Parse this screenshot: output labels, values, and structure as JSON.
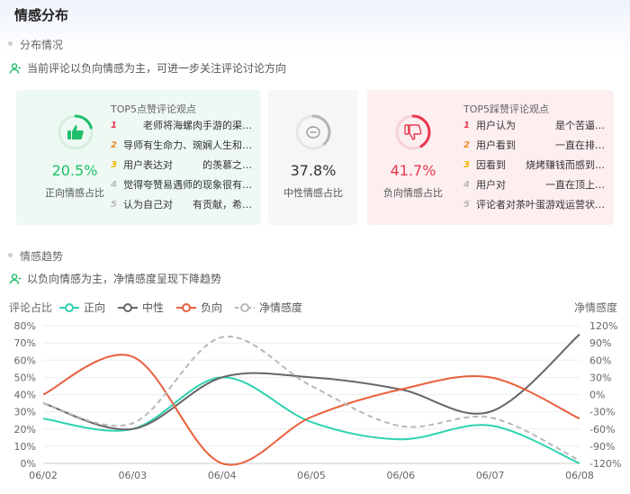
{
  "title": "情感分布",
  "distribution": {
    "label": "分布情况",
    "note": "当前评论以负向情感为主，可进一步关注评论讨论方向",
    "positive": {
      "value": 20.5,
      "pct_text": "20.5%",
      "label": "正向情感占比",
      "color": "#1fbf6b",
      "top_title": "TOP5点赞评论观点",
      "items": [
        {
          "rank": "1",
          "text": "　　老师将海螺肉手游的渠…"
        },
        {
          "rank": "2",
          "text": "导师有生命力、琬娴人生和…"
        },
        {
          "rank": "3",
          "text": "用户表达对　　　的羡慕之…"
        },
        {
          "rank": "4",
          "text": "觉得夸赞易遇师的现象很有…"
        },
        {
          "rank": "5",
          "text": "认为自己对　　有贡献，希…"
        }
      ]
    },
    "neutral": {
      "value": 37.8,
      "pct_text": "37.8%",
      "label": "中性情感占比",
      "color": "#999999"
    },
    "negative": {
      "value": 41.7,
      "pct_text": "41.7%",
      "label": "负向情感占比",
      "color": "#e8384f",
      "top_title": "TOP5踩赞评论观点",
      "items": [
        {
          "rank": "1",
          "text": "用户认为　　　　是个苦逼…"
        },
        {
          "rank": "2",
          "text": "用户看到　　　　一直在排…"
        },
        {
          "rank": "3",
          "text": "因看到　　烧烤赚钱而感到…"
        },
        {
          "rank": "4",
          "text": "用户对　　　　一直在顶上…"
        },
        {
          "rank": "5",
          "text": "评论者对茶叶蛋游戏运营状…"
        }
      ]
    }
  },
  "trend": {
    "label": "情感趋势",
    "note": "以负向情感为主，净情感度呈现下降趋势"
  },
  "chart_data": {
    "type": "line",
    "x": [
      "06/02",
      "06/03",
      "06/04",
      "06/05",
      "06/06",
      "06/07",
      "06/08"
    ],
    "ylabel": "评论占比",
    "y2label": "净情感度",
    "ylim": [
      0,
      80
    ],
    "y_ticks": [
      "0%",
      "10%",
      "20%",
      "30%",
      "40%",
      "50%",
      "60%",
      "70%",
      "80%"
    ],
    "y2lim": [
      -120,
      120
    ],
    "y2_ticks": [
      "-120%",
      "-90%",
      "-60%",
      "-30%",
      "0%",
      "30%",
      "60%",
      "90%",
      "120%"
    ],
    "grid": true,
    "legend_position": "top-left",
    "series": [
      {
        "name": "正向",
        "axis": "left",
        "color": "#2ed3b0",
        "dashed": false,
        "values": [
          26,
          20,
          50,
          24,
          14,
          22,
          0
        ]
      },
      {
        "name": "中性",
        "axis": "left",
        "color": "#666666",
        "dashed": false,
        "values": [
          35,
          20,
          50,
          50,
          43,
          30,
          75
        ]
      },
      {
        "name": "负向",
        "axis": "left",
        "color": "#e8603c",
        "dashed": false,
        "values": [
          40,
          62,
          0,
          27,
          43,
          50,
          26
        ]
      },
      {
        "name": "净情感度",
        "axis": "right",
        "color": "#b8b8b8",
        "dashed": true,
        "values": [
          -15,
          -50,
          100,
          15,
          -55,
          -40,
          -115
        ]
      }
    ]
  }
}
